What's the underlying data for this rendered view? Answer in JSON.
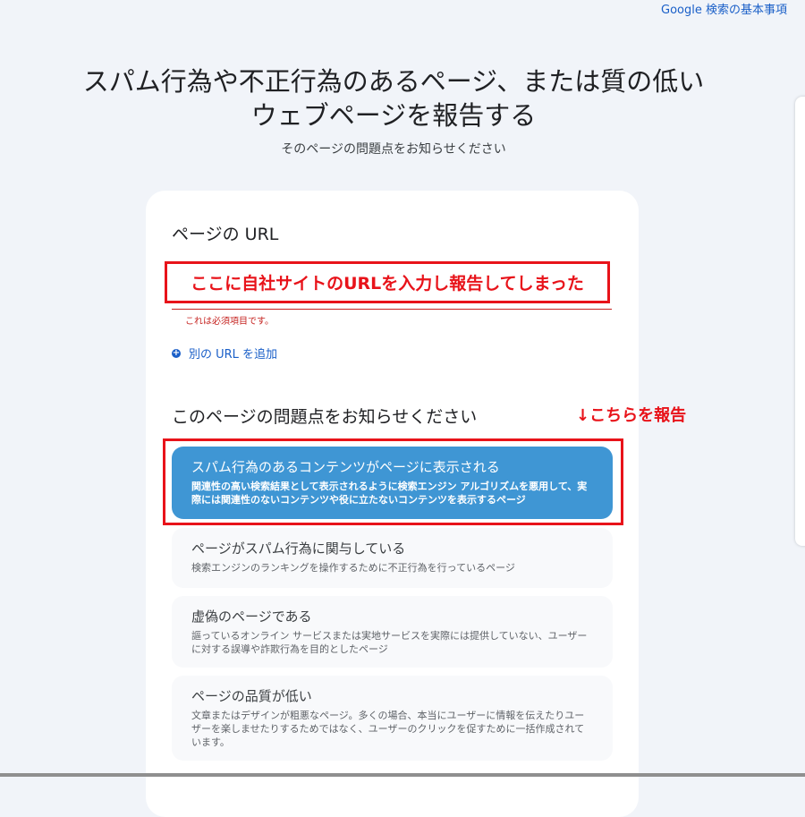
{
  "header": {
    "help_link": "Google 検索の基本事項"
  },
  "page": {
    "title": "スパム行為や不正行為のあるページ、または質の低いウェブページを報告する",
    "subtitle": "そのページの問題点をお知らせください"
  },
  "url_section": {
    "heading": "ページの URL",
    "error": "これは必須項目です。",
    "add_url": "別の URL を追加"
  },
  "issue_section": {
    "heading": "このページの問題点をお知らせください",
    "options": [
      {
        "title": "スパム行為のあるコンテンツがページに表示される",
        "desc": "関連性の高い検索結果として表示されるように検索エンジン アルゴリズムを悪用して、実際には関連性のないコンテンツや役に立たないコンテンツを表示するページ",
        "selected": true
      },
      {
        "title": "ページがスパム行為に関与している",
        "desc": "検索エンジンのランキングを操作するために不正行為を行っているページ"
      },
      {
        "title": "虚偽のページである",
        "desc": "謳っているオンライン サービスまたは実地サービスを実際には提供していない、ユーザーに対する誤導や詐欺行為を目的としたページ"
      },
      {
        "title": "ページの品質が低い",
        "desc": "文章またはデザインが粗悪なページ。多くの場合、本当にユーザーに情報を伝えたりユーザーを楽しませたりするためではなく、ユーザーのクリックを促すために一括作成されています。"
      }
    ]
  },
  "annotations": {
    "url_note": "ここに自社サイトのURLを入力し報告してしまった",
    "option_note": "↓こちらを報告"
  },
  "colors": {
    "accent": "#3f96d4",
    "annotation": "#e8131a",
    "error": "#c5221f"
  }
}
